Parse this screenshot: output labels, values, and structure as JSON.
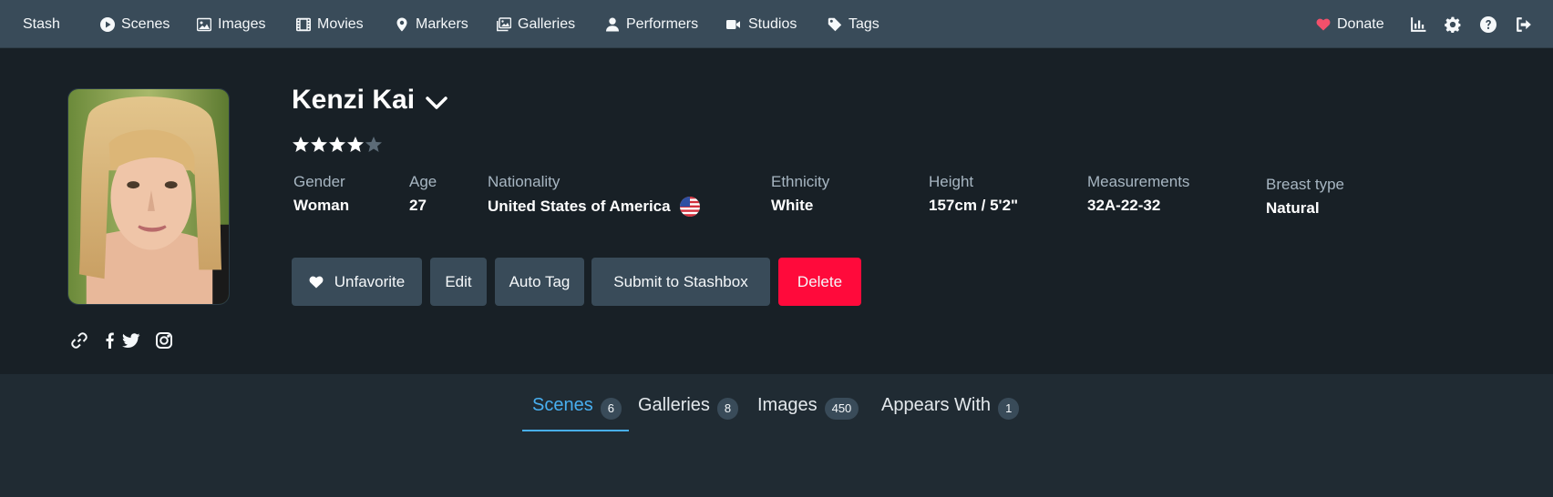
{
  "nav": {
    "brand": "Stash",
    "links": [
      "Scenes",
      "Images",
      "Movies",
      "Markers",
      "Galleries",
      "Performers",
      "Studios",
      "Tags"
    ],
    "donate": "Donate",
    "right_icons": [
      "stats-icon",
      "settings-icon",
      "help-icon",
      "logout-icon"
    ]
  },
  "performer": {
    "name": "Kenzi Kai",
    "rating": 4,
    "rating_max": 5,
    "details": {
      "gender": {
        "label": "Gender",
        "value": "Woman"
      },
      "age": {
        "label": "Age",
        "value": "27"
      },
      "nationality": {
        "label": "Nationality",
        "value": "United States of America"
      },
      "ethnicity": {
        "label": "Ethnicity",
        "value": "White"
      },
      "height": {
        "label": "Height",
        "value": "157cm / 5'2\""
      },
      "measurements": {
        "label": "Measurements",
        "value": "32A-22-32"
      },
      "breast_type": {
        "label": "Breast type",
        "value": "Natural"
      }
    },
    "links": [
      "link-icon",
      "facebook-icon",
      "twitter-icon",
      "instagram-icon"
    ]
  },
  "actions": {
    "unfavorite": "Unfavorite",
    "edit": "Edit",
    "auto_tag": "Auto Tag",
    "submit": "Submit to Stashbox",
    "delete": "Delete"
  },
  "tabs": [
    {
      "label": "Scenes",
      "count": "6",
      "active": true
    },
    {
      "label": "Galleries",
      "count": "8",
      "active": false
    },
    {
      "label": "Images",
      "count": "450",
      "active": false
    },
    {
      "label": "Appears With",
      "count": "1",
      "active": false
    }
  ],
  "colors": {
    "navbar": "#394b59",
    "header_bg": "#182026",
    "page_bg": "#202b33",
    "accent": "#48aff0",
    "danger": "#ff0a3b",
    "donate_heart": "#f2506b"
  }
}
